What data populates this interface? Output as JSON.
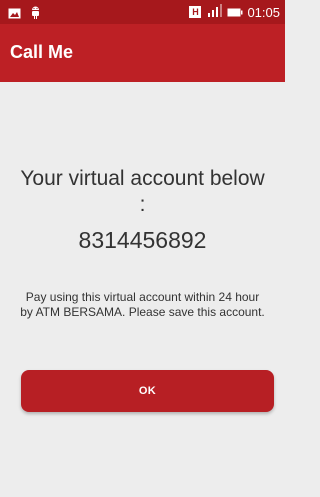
{
  "status_bar": {
    "time": "01:05",
    "icons": [
      "image-icon",
      "android-icon",
      "h-network-icon",
      "signal-icon",
      "battery-icon"
    ],
    "network_badge": "H"
  },
  "app_bar": {
    "title": "Call Me",
    "background": "#bd2025"
  },
  "dialog": {
    "headline": "Your virtual account below :",
    "account_number": "8314456892",
    "message": "Pay using this virtual account within 24 hour by ATM BERSAMA. Please save this account.",
    "ok_label": "OK"
  },
  "colors": {
    "status_bar": "#a6181c",
    "primary": "#bd2025",
    "button": "#b71f24",
    "background": "#ededed"
  }
}
